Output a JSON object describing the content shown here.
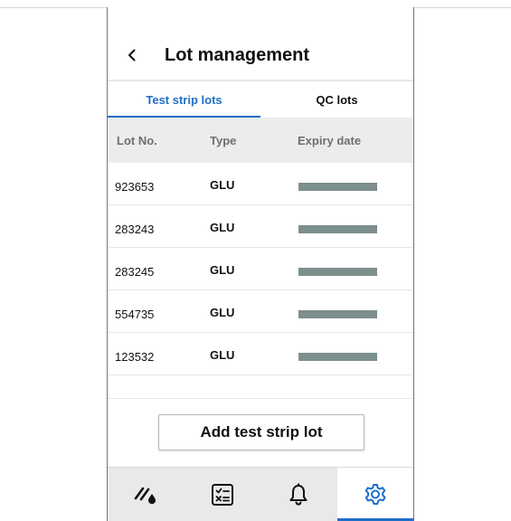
{
  "header": {
    "title": "Lot management",
    "back_icon": "chevron-left-icon"
  },
  "tabs": [
    {
      "label": "Test strip lots",
      "active": true
    },
    {
      "label": "QC lots",
      "active": false
    }
  ],
  "table": {
    "columns": [
      "Lot No.",
      "Type",
      "Expiry date"
    ],
    "rows": [
      {
        "lot": "923653",
        "type": "GLU",
        "expiry": "redacted-bar"
      },
      {
        "lot": "283243",
        "type": "GLU",
        "expiry": "redacted-bar"
      },
      {
        "lot": "283245",
        "type": "GLU",
        "expiry": "redacted-bar"
      },
      {
        "lot": "554735",
        "type": "GLU",
        "expiry": "redacted-bar"
      },
      {
        "lot": "123532",
        "type": "GLU",
        "expiry": "redacted-bar"
      }
    ]
  },
  "add_button": {
    "label": "Add test strip lot"
  },
  "bottom_nav": [
    {
      "icon": "test-drop-icon",
      "active": false
    },
    {
      "icon": "checklist-icon",
      "active": false
    },
    {
      "icon": "bell-icon",
      "active": false
    },
    {
      "icon": "gear-icon",
      "active": true
    }
  ],
  "colors": {
    "accent": "#1e6fc9",
    "redaction_bar": "#7c8f8d",
    "header_bg": "#ececec",
    "nav_bg": "#e9e9e9"
  }
}
